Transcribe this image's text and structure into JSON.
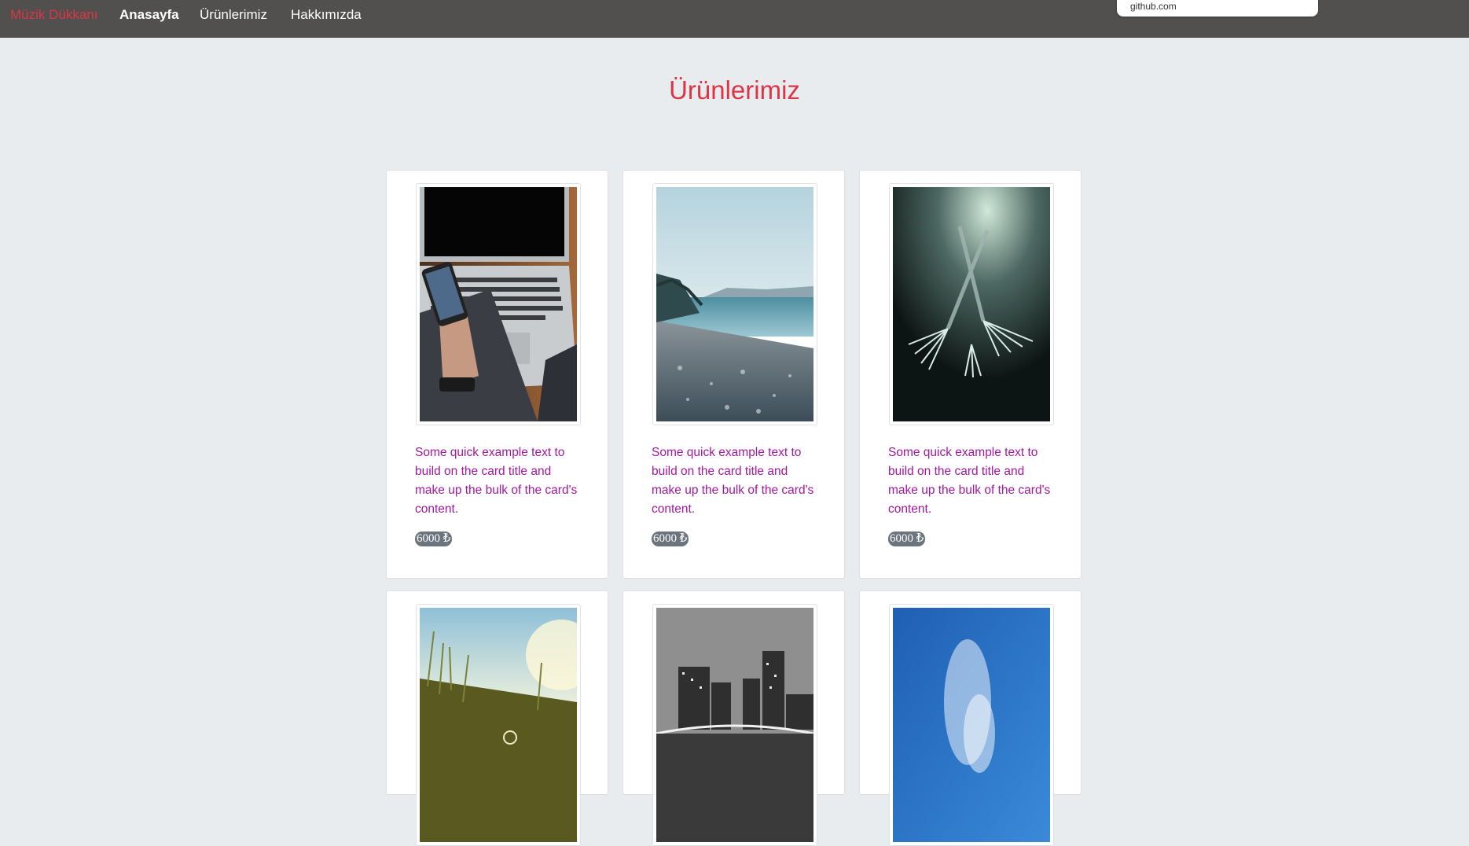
{
  "navbar": {
    "brand": "Müzik Dükkanı",
    "links": [
      "Anasayfa",
      "Ürünlerimiz",
      "Hakkımızda"
    ],
    "active_index": 0
  },
  "popup": {
    "text": "github.com"
  },
  "page": {
    "title": "Ürünlerimiz"
  },
  "products": [
    {
      "image": "laptop-phone-photo",
      "text": "Some quick example text to build on the card title and make up the bulk of the card's content.",
      "price": "6000 ₺"
    },
    {
      "image": "beach-photo",
      "text": "Some quick example text to build on the card title and make up the bulk of the card's content.",
      "price": "6000 ₺"
    },
    {
      "image": "forks-photo",
      "text": "Some quick example text to build on the card title and make up the bulk of the card's content.",
      "price": "6000 ₺"
    },
    {
      "image": "grass-photo"
    },
    {
      "image": "city-night-photo"
    },
    {
      "image": "blue-sky-photo"
    }
  ],
  "colors": {
    "navbar_bg": "#51504f",
    "brand": "#dc3545",
    "title": "#dc3545",
    "card_text": "#a0199e",
    "price_badge": "#6c757d",
    "page_bg": "#e9ecef"
  }
}
